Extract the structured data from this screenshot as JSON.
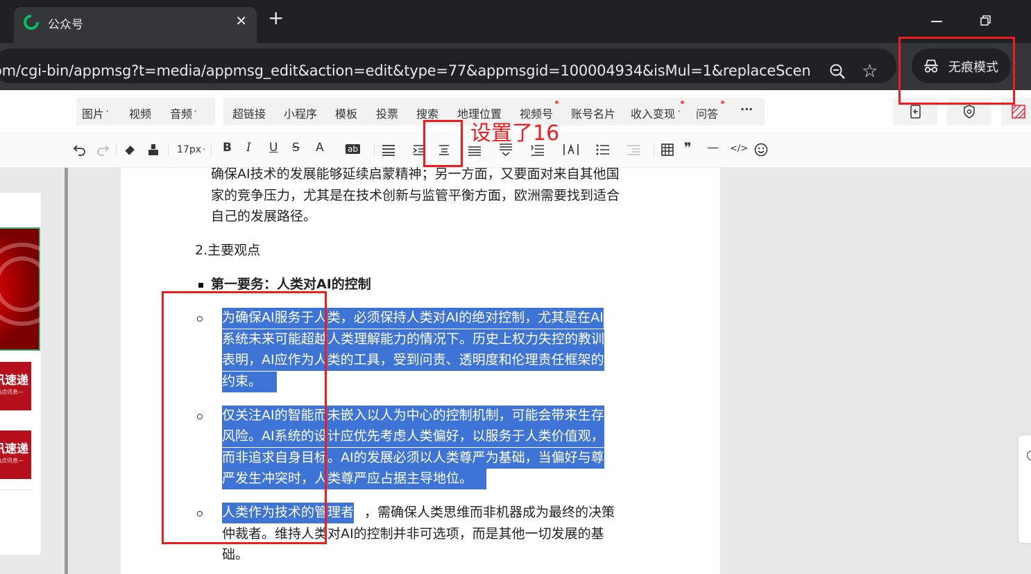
{
  "browser": {
    "tab_title": "公众号",
    "tab_close": "✕",
    "new_tab": "+",
    "url": "om/cgi-bin/appmsg?t=media/appmsg_edit&action=edit&type=77&appmsgid=100004934&isMul=1&replaceScene...",
    "incognito_label": "无痕模式",
    "bookmark_glyph": "☆"
  },
  "ribbon": {
    "media": [
      "图片",
      "视频",
      "音频"
    ],
    "insert": [
      "超链接",
      "小程序",
      "模板",
      "投票",
      "搜索",
      "地理位置",
      "视频号",
      "账号名片",
      "收入变现",
      "问答"
    ],
    "more": "···",
    "dropdown_caret": "·"
  },
  "format_toolbar": {
    "font_size": "17px",
    "bold": "B",
    "italic": "I",
    "underline": "U",
    "strike": "S",
    "font_color": "A",
    "bg_color": "ab",
    "quote": "❞",
    "code": "</>",
    "hr": "—"
  },
  "left_panel": {
    "thumb_title": "讯速递",
    "thumb_sub": "热点讯息—"
  },
  "document": {
    "intro_lines": [
      "确保AI技术的发展能够延续启蒙精神；另一方面，又要面对来自其他国",
      "家的竞争压力，尤其是在技术创新与监管平衡方面，欧洲需要找到适合",
      "自己的发展路径。"
    ],
    "section_heading": "2.主要观点",
    "bullet_heading": "第一要务：人类对AI的控制",
    "point1_lines": [
      "为确保AI服务于人类，必须保持人类对AI的绝对控制，尤其是在AI",
      "系统未来可能超越人类理解能力的情况下。历史上权力失控的教训",
      "表明，AI应作为人类的工具，受到问责、透明度和伦理责任框架的",
      "约束。"
    ],
    "point2_lines": [
      "仅关注AI的智能而未嵌入以人为中心的控制机制，可能会带来生存",
      "风险。AI系统的设计应优先考虑人类偏好，以服务于人类价值观，",
      "而非追求自身目标。AI的发展必须以人类尊严为基础，当偏好与尊",
      "严发生冲突时，人类尊严应占据主导地位。"
    ],
    "point3_line1_selected": "人类作为技术的管理者",
    "point3_line1_rest": "，需确保人类思维而非机器成为最终的决策",
    "point3_lines_rest": [
      "仲裁者。维持人类对AI的控制并非可选项，而是其他一切发展的基",
      "础。"
    ]
  },
  "annotation": {
    "text": "设置了16",
    "color": "#f21b1b"
  },
  "colors": {
    "selection": "#3d74d6",
    "chrome_dark": "#202124",
    "chrome_mid": "#35363a",
    "wechat_green": "#07c160"
  }
}
